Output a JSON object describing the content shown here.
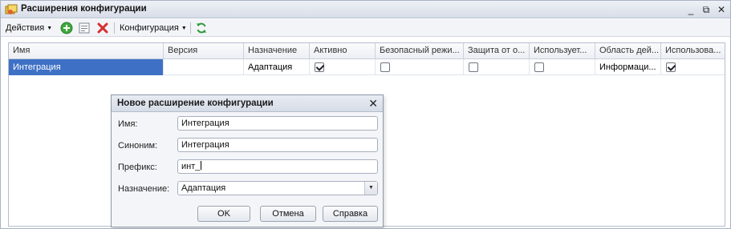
{
  "window": {
    "title": "Расширения конфигурации",
    "minimize": "_",
    "restore": "⧉",
    "close": "✕"
  },
  "toolbar": {
    "actions_label": "Действия",
    "configuration_label": "Конфигурация",
    "icons": [
      "add-icon",
      "edit-icon",
      "delete-icon",
      "refresh-icon"
    ],
    "colors": {
      "add": "#3fa83f",
      "delete": "#d53030",
      "refresh": "#2b9a3a"
    }
  },
  "grid": {
    "columns": [
      "Имя",
      "Версия",
      "Назначение",
      "Активно",
      "Безопасный режи...",
      "Защита от о...",
      "Использует...",
      "Область дей...",
      "Использова..."
    ],
    "rows": [
      {
        "name": "Интеграция",
        "version": "",
        "purpose": "Адаптация",
        "active": true,
        "safe_mode": false,
        "protection": false,
        "uses": false,
        "scope": "Информаци...",
        "used": true
      }
    ],
    "selection_color": "#3e71c6"
  },
  "dialog": {
    "title": "Новое расширение конфигурации",
    "close": "✕",
    "fields": {
      "name_label": "Имя:",
      "name_value": "Интеграция",
      "synonym_label": "Синоним:",
      "synonym_value": "Интеграция",
      "prefix_label": "Префикс:",
      "prefix_value": "инт_",
      "purpose_label": "Назначение:",
      "purpose_value": "Адаптация"
    },
    "buttons": {
      "ok": "OK",
      "cancel": "Отмена",
      "help": "Справка"
    }
  }
}
